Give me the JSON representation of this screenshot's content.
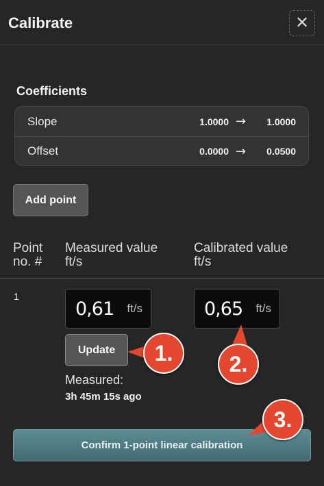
{
  "dialog": {
    "title": "Calibrate",
    "close_icon": "close-icon"
  },
  "coefficients": {
    "heading": "Coefficients",
    "rows": [
      {
        "label": "Slope",
        "old": "1.0000",
        "new": "1.0000"
      },
      {
        "label": "Offset",
        "old": "0.0000",
        "new": "0.0500"
      }
    ],
    "arrow_icon": "arrow-right-icon"
  },
  "add_point_label": "Add point",
  "table": {
    "headers": {
      "point": [
        "Point",
        "no. #"
      ],
      "measured": {
        "label": "Measured value",
        "unit": "ft/s"
      },
      "calibrated": {
        "label": "Calibrated value",
        "unit": "ft/s"
      }
    },
    "rows": [
      {
        "number": "1",
        "measured_value": "0,61",
        "measured_unit": "ft/s",
        "calibrated_value": "0,65",
        "calibrated_unit": "ft/s",
        "update_label": "Update",
        "measured_label": "Measured:",
        "measured_ago": "3h 45m 15s ago"
      }
    ]
  },
  "confirm_label": "Confirm 1-point linear calibration",
  "annotations": [
    "1.",
    "2.",
    "3."
  ],
  "colors": {
    "background": "#262626",
    "marker": "#e4472f",
    "confirm": "#4f7c85"
  }
}
